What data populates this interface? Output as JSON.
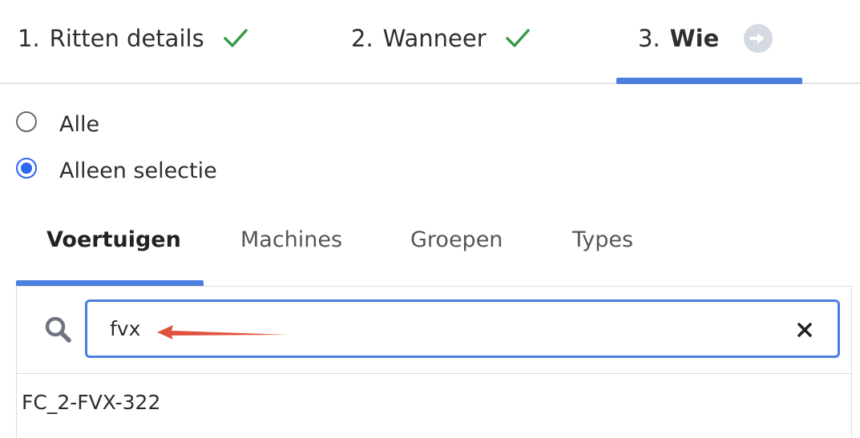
{
  "steps": [
    {
      "number": "1.",
      "label": "Ritten details",
      "status": "completed"
    },
    {
      "number": "2.",
      "label": "Wanneer",
      "status": "completed"
    },
    {
      "number": "3.",
      "label": "Wie",
      "status": "current"
    }
  ],
  "recipients": {
    "options": [
      {
        "label": "Alle",
        "selected": false
      },
      {
        "label": "Alleen selectie",
        "selected": true
      }
    ]
  },
  "tabs": [
    {
      "label": "Voertuigen",
      "active": true
    },
    {
      "label": "Machines",
      "active": false
    },
    {
      "label": "Groepen",
      "active": false
    },
    {
      "label": "Types",
      "active": false
    }
  ],
  "search": {
    "value": "fvx",
    "placeholder": ""
  },
  "results": [
    {
      "label": "FC_2-FVX-322"
    }
  ],
  "colors": {
    "accent": "#4a7fe0",
    "check": "#3a9a4a",
    "radio_selected": "#2f66f0",
    "annotation_arrow": "#e0523f"
  },
  "icons": {
    "completed": "check-icon",
    "next": "arrow-right-circle-icon",
    "search": "search-icon",
    "clear": "close-icon"
  }
}
